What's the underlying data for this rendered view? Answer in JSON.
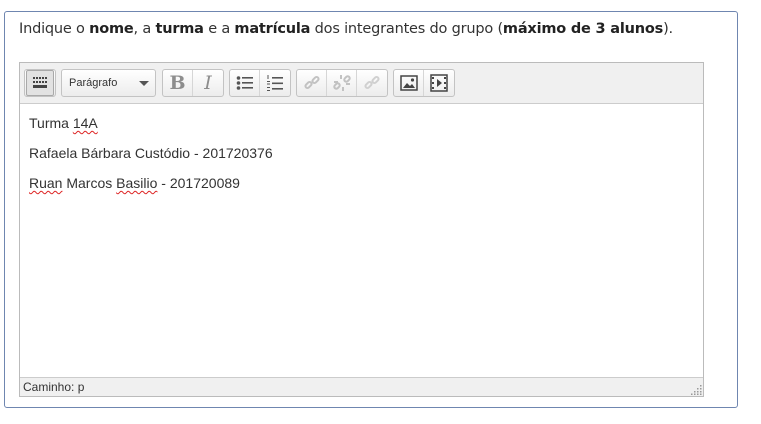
{
  "question": {
    "prefix": "Indique o ",
    "b1": "nome",
    "t1": ", a ",
    "b2": "turma",
    "t2": " e a ",
    "b3": "matrícula",
    "t3": " dos integrantes do grupo (",
    "b4": "máximo de 3 alunos",
    "t4": ")."
  },
  "toolbar": {
    "format_select": "Parágrafo",
    "bold_label": "B",
    "italic_label": "I",
    "icons": [
      "toolbar-toggle-icon",
      "bold-icon",
      "italic-icon",
      "bullet-list-icon",
      "numbered-list-icon",
      "link-icon",
      "unlink-icon",
      "anchor-icon",
      "image-icon",
      "media-icon"
    ]
  },
  "content": {
    "line1_a": "Turma ",
    "line1_b": "14A",
    "line2": "Rafaela Bárbara Custódio - 201720376",
    "line3_a": "Ruan",
    "line3_b": " Marcos ",
    "line3_c": "Basilio",
    "line3_d": " - 201720089"
  },
  "statusbar": {
    "path": "Caminho: p"
  }
}
